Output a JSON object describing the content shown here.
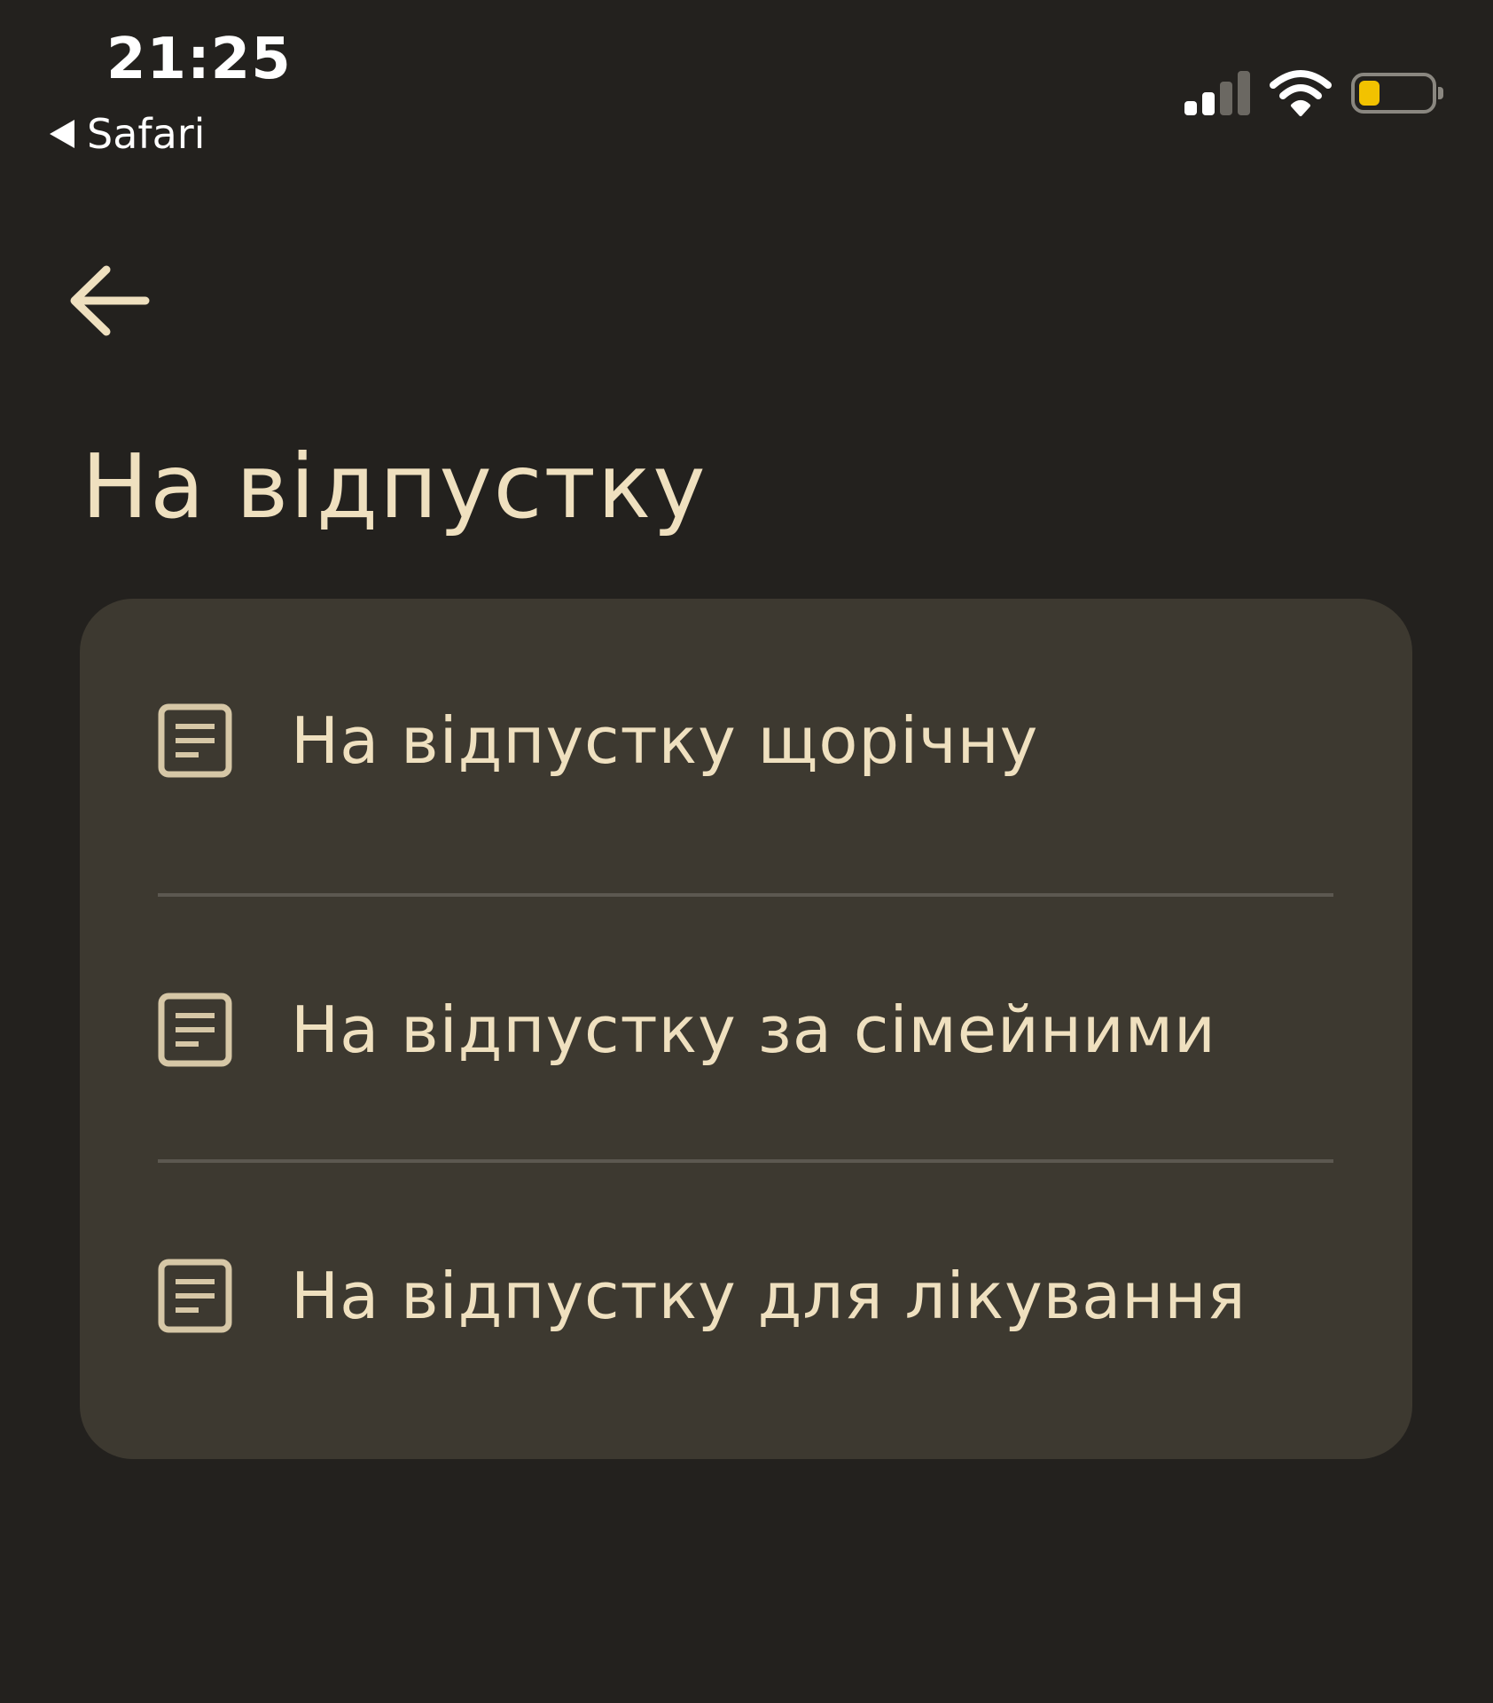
{
  "status_bar": {
    "time": "21:25",
    "back_app": "Safari",
    "battery_level": 0.3,
    "signal_bars": 2,
    "signal_bars_total": 4
  },
  "colors": {
    "background": "#23211e",
    "card": "#3d3930",
    "accent_text": "#efe0bf",
    "battery_fill": "#f2c200"
  },
  "header": {
    "back_icon": "arrow-left-icon",
    "title": "На відпустку"
  },
  "menu": {
    "items": [
      {
        "icon": "document-icon",
        "label": "На відпустку щорічну"
      },
      {
        "icon": "document-icon",
        "label": "На відпустку за сімейними"
      },
      {
        "icon": "document-icon",
        "label": "На відпустку для лікування"
      }
    ]
  }
}
